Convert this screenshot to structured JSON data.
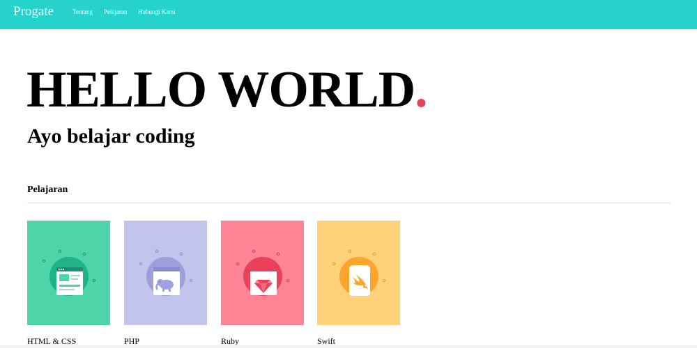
{
  "navbar": {
    "brand": "Progate",
    "links": [
      "Tentang",
      "Pelajaran",
      "Hubungi Kami"
    ],
    "background": "#26d3cc"
  },
  "hero": {
    "title": "HELLO WORLD",
    "dot": ".",
    "subtitle": "Ayo belajar coding",
    "accent": "#e8425a"
  },
  "lessons": {
    "heading": "Pelajaran",
    "items": [
      {
        "label": "HTML & CSS",
        "icon": "browser-window-icon",
        "color": "#4dd4a9"
      },
      {
        "label": "PHP",
        "icon": "elephant-icon",
        "color": "#c3c4ec"
      },
      {
        "label": "Ruby",
        "icon": "gem-icon",
        "color": "#ff8495"
      },
      {
        "label": "Swift",
        "icon": "swift-bird-icon",
        "color": "#ffd27a"
      }
    ]
  }
}
